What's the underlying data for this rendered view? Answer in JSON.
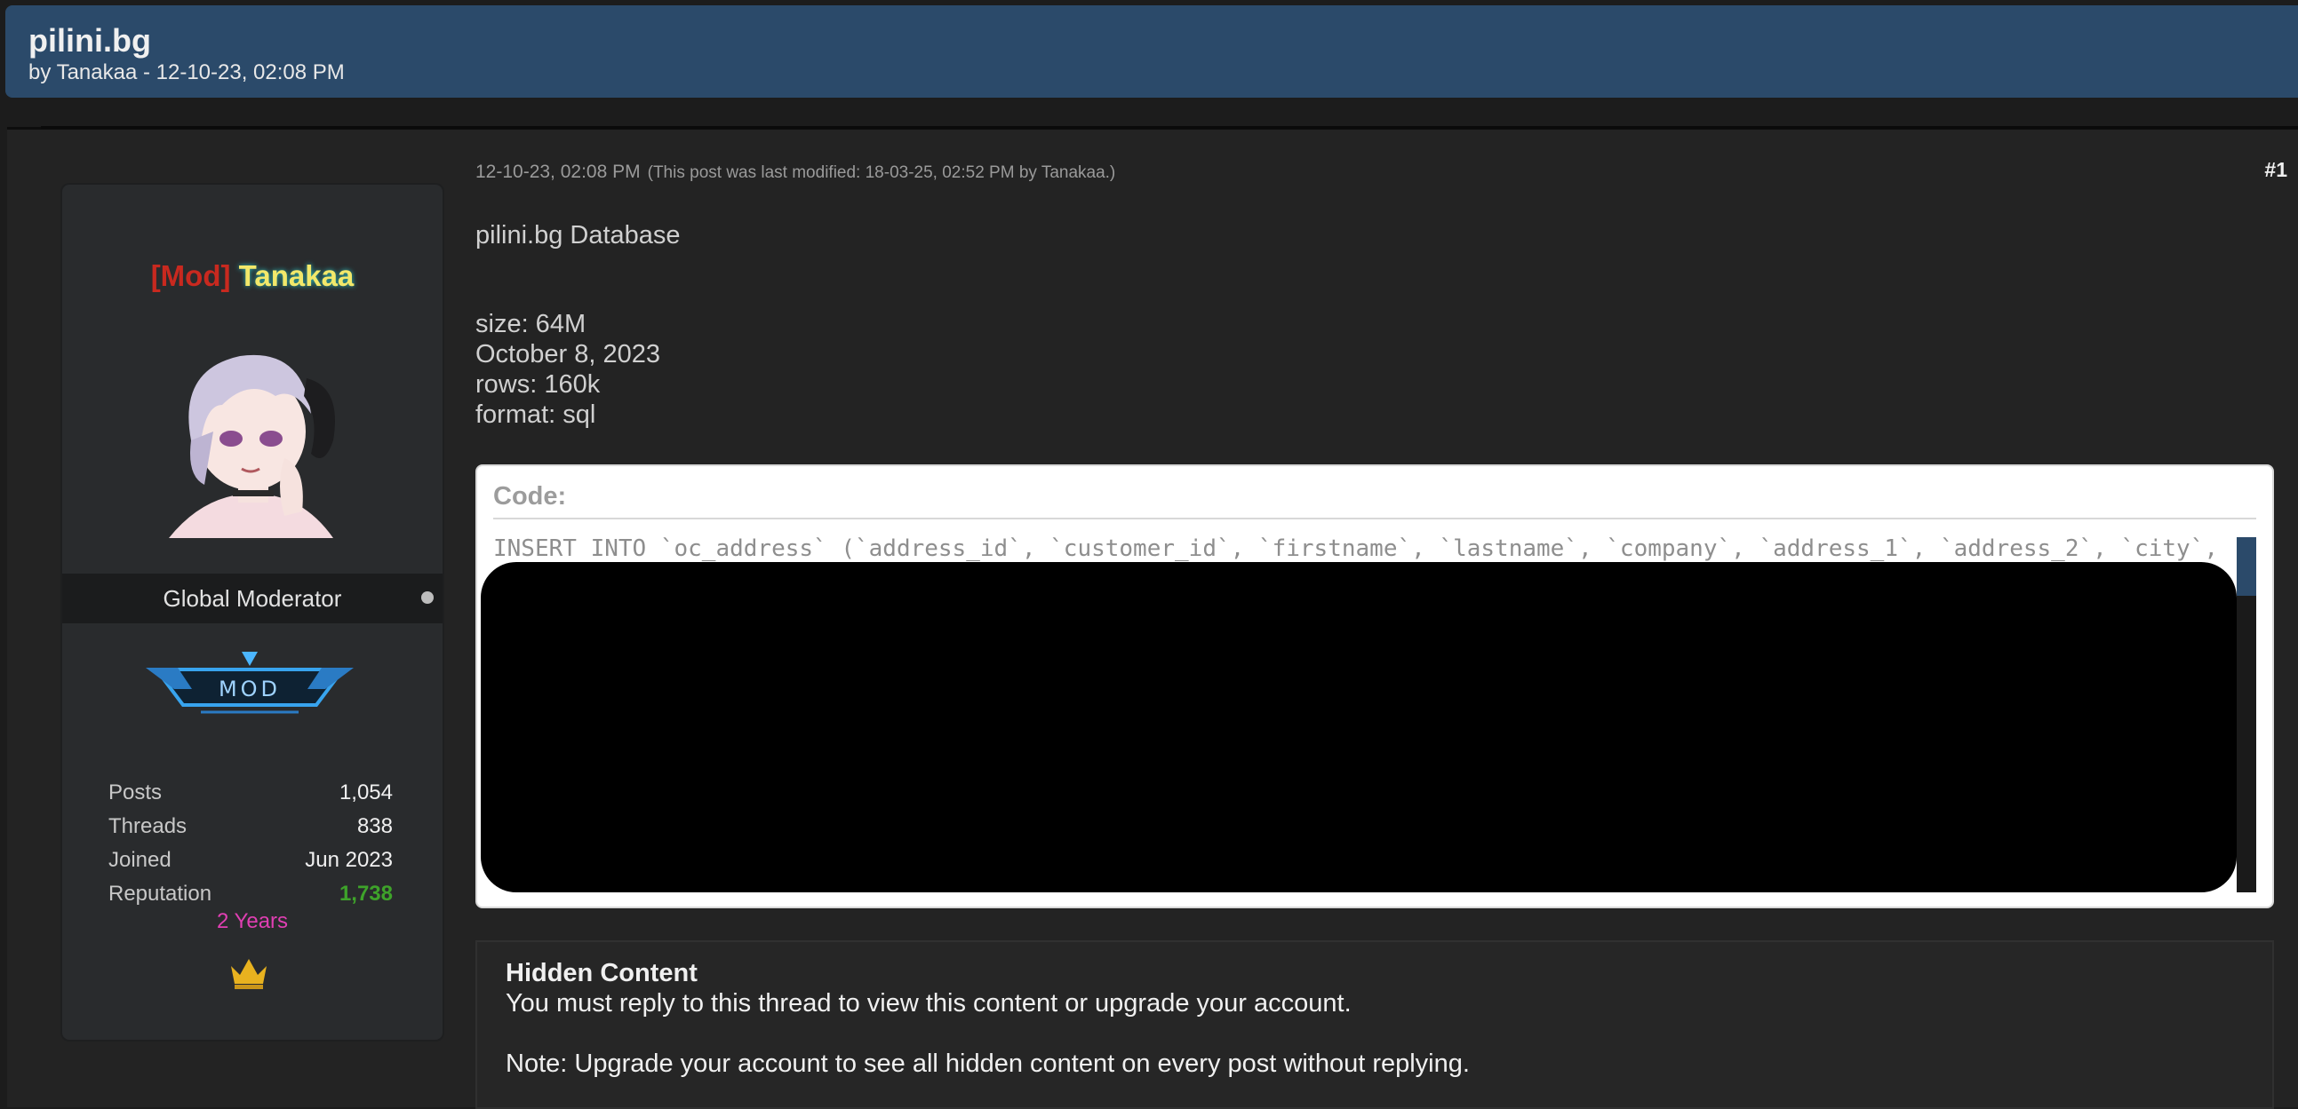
{
  "thread": {
    "title": "pilini.bg",
    "meta": "by Tanakaa - 12-10-23, 02:08 PM"
  },
  "profile": {
    "mod_tag": "[Mod]",
    "username": "Tanakaa",
    "role": "Global Moderator",
    "badge_text": "MOD",
    "stats": [
      {
        "label": "Posts",
        "value": "1,054"
      },
      {
        "label": "Threads",
        "value": "838"
      },
      {
        "label": "Joined",
        "value": "Jun 2023"
      },
      {
        "label": "Reputation",
        "value": "1,738"
      }
    ],
    "years": "2 Years",
    "icons": {
      "avatar": "anime-avatar-icon",
      "badge": "mod-badge-icon",
      "crown": "crown-icon",
      "status": "online-status-icon"
    },
    "colors": {
      "mod_tag": "#c8291f",
      "username": "#f2e86a",
      "reputation": "#3ea32a",
      "years": "#e03fb3"
    }
  },
  "post": {
    "date": "12-10-23, 02:08 PM",
    "edited": "(This post was last modified: 18-03-25, 02:52 PM by Tanakaa.)",
    "number": "#1",
    "heading": "pilini.bg Database",
    "info": [
      "size: 64M",
      "October 8, 2023",
      "rows: 160k",
      "format: sql"
    ],
    "code_label": "Code:",
    "code_line": "INSERT INTO `oc_address` (`address_id`, `customer_id`, `firstname`, `lastname`, `company`, `address_1`, `address_2`, `city`,"
  },
  "hidden": {
    "title": "Hidden Content",
    "text": "You must reply to this thread to view this content or upgrade your account.",
    "note": "Note: Upgrade your account to see all hidden content on every post without replying."
  },
  "theme": {
    "header_bg": "#2b4a6a",
    "page_bg": "#1c1c1c",
    "post_bg": "#232323"
  }
}
